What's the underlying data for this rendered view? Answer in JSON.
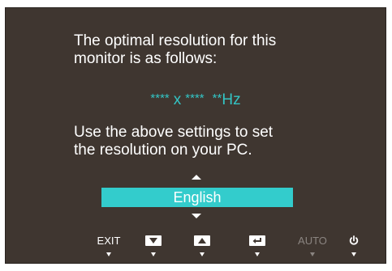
{
  "message": {
    "line1": "The optimal resolution for this",
    "line2": "monitor is as follows:",
    "resolution_width": "****",
    "resolution_x": "x",
    "resolution_height": "****",
    "refresh_rate_stars": "**",
    "refresh_rate_unit": "Hz",
    "line3": "Use the above settings to set",
    "line4": "the resolution on your PC."
  },
  "language": {
    "selected": "English"
  },
  "buttons": {
    "exit_label": "EXIT",
    "auto_label": "AUTO"
  },
  "icons": {
    "down_button": "down-arrow-key-icon",
    "up_button": "up-arrow-key-icon",
    "enter_button": "enter-key-icon",
    "power_button": "power-icon",
    "scroll_up": "scroll-up-arrow-icon",
    "scroll_down": "scroll-down-arrow-icon"
  },
  "colors": {
    "background": "#3f3630",
    "accent": "#33cccc",
    "text": "#ffffff",
    "disabled": "#8a8480"
  }
}
